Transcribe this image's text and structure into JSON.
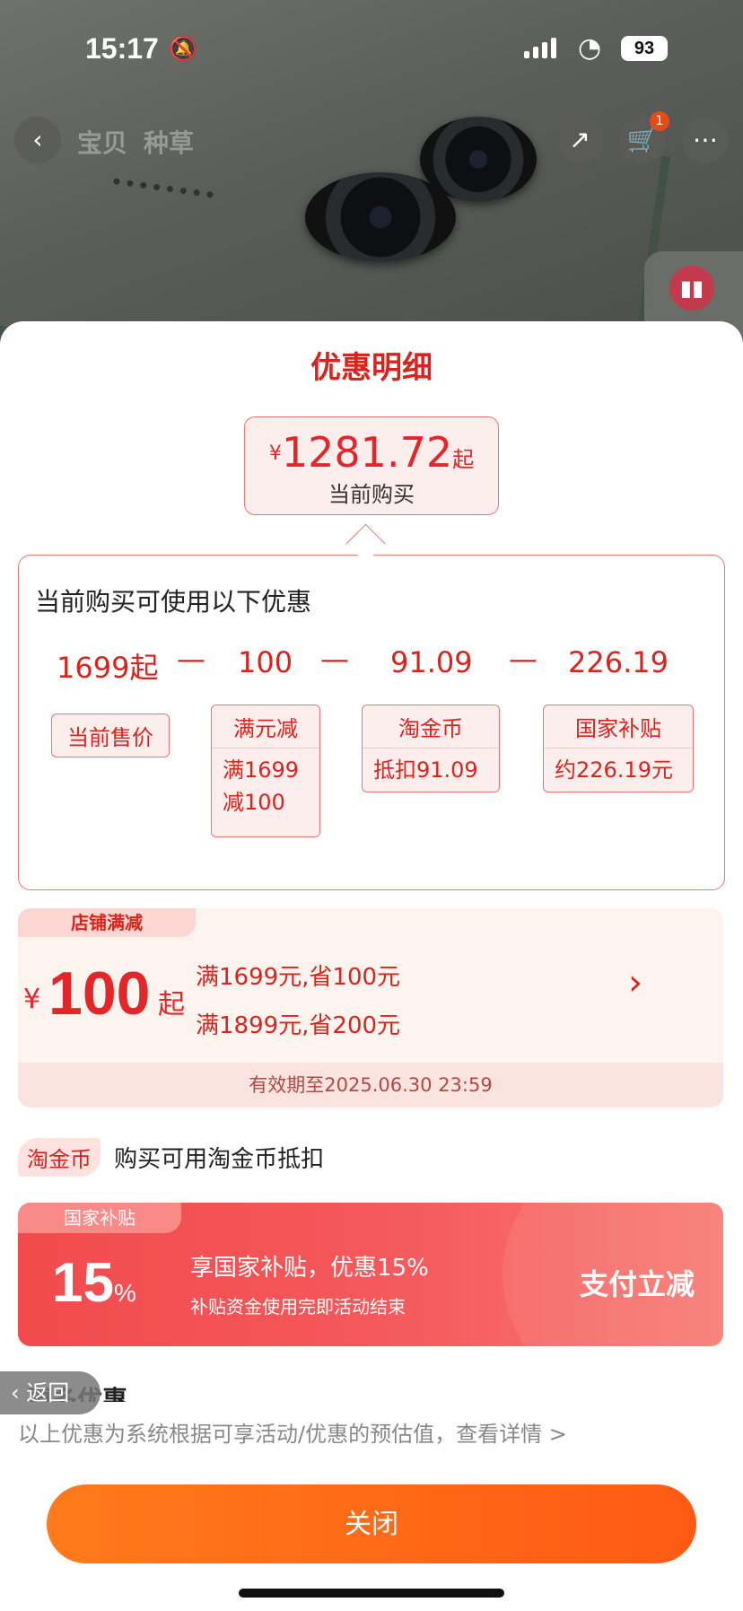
{
  "status": {
    "time": "15:17",
    "battery": "93"
  },
  "topnav": {
    "tab_item": "宝贝",
    "tab_reviews": "种草",
    "cart_count": "1"
  },
  "sheet": {
    "title": "优惠明细",
    "price": {
      "currency": "¥",
      "value": "1281.72",
      "suffix": "起",
      "label": "当前购买"
    },
    "detail": {
      "heading": "当前购买可使用以下优惠",
      "amounts": [
        "1699起",
        "100",
        "91.09",
        "226.19"
      ],
      "minus": "—",
      "tags": [
        {
          "head": "当前售价"
        },
        {
          "head": "满元减",
          "body": "满1699减100"
        },
        {
          "head": "淘金币",
          "body": "抵扣91.09"
        },
        {
          "head": "国家补贴",
          "body": "约226.19元"
        }
      ]
    },
    "shop": {
      "tag": "店铺满减",
      "currency": "¥",
      "value": "100",
      "suffix": "起",
      "rule1": "满1699元,省100元",
      "rule2": "满1899元,省200元",
      "validity": "有效期至2025.06.30 23:59"
    },
    "coin": {
      "tag": "淘金币",
      "text": "购买可用淘金币抵扣"
    },
    "gov": {
      "tag": "国家补贴",
      "pct": "15",
      "pct_unit": "%",
      "line1": "享国家补贴，优惠15%",
      "line2": "补贴资金使用完即活动结束",
      "action": "支付立减"
    },
    "back_label": "返回",
    "hidden_heading": "更多优惠",
    "disclaimer": "以上优惠为系统根据可享活动/优惠的预估值，查看详情 >",
    "close": "关闭"
  }
}
